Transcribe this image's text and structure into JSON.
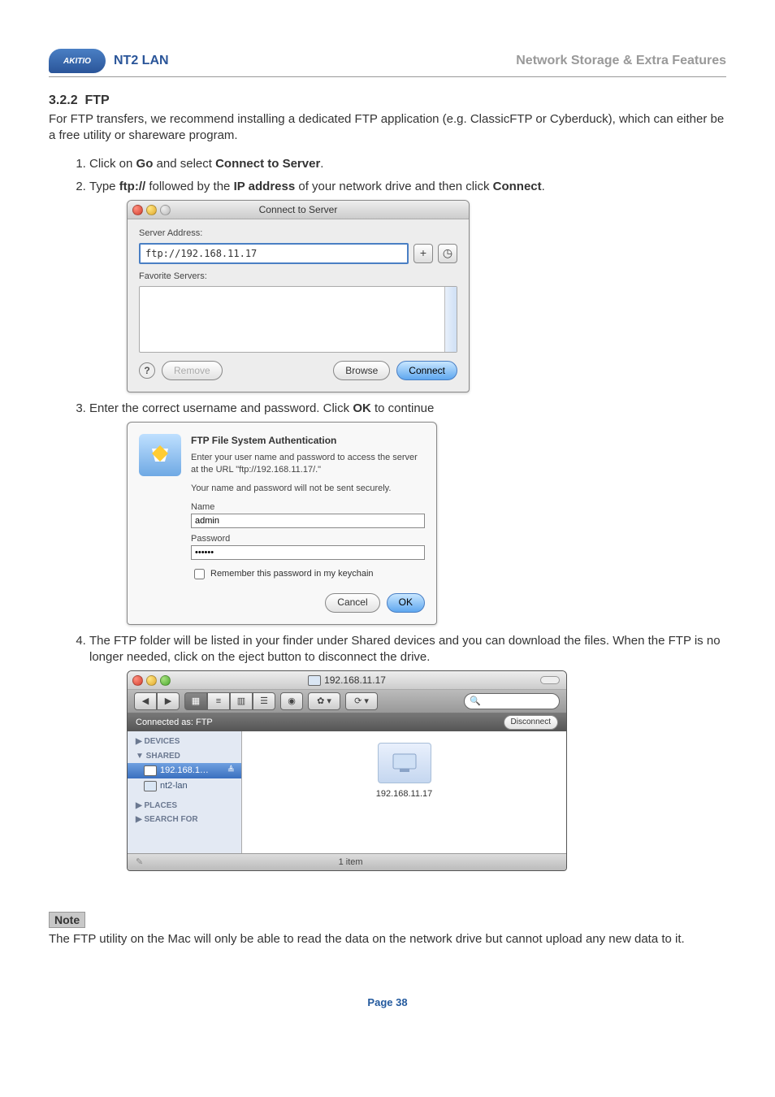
{
  "header": {
    "logo": "AKITIO",
    "title": "NT2 LAN",
    "right": "Network Storage & Extra Features"
  },
  "section": {
    "num": "3.2.2",
    "title": "FTP"
  },
  "intro": "For FTP transfers, we recommend installing a dedicated FTP application (e.g. ClassicFTP or Cyberduck), which can either be a free utility or shareware program.",
  "steps": {
    "s1a": "Click on ",
    "s1b": "Go",
    "s1c": " and select ",
    "s1d": "Connect to Server",
    "s1e": ".",
    "s2a": "Type ",
    "s2b": "ftp://",
    "s2c": " followed by the ",
    "s2d": "IP address",
    "s2e": " of your network drive and then click ",
    "s2f": "Connect",
    "s2g": ".",
    "s3a": "Enter the correct username and password. Click ",
    "s3b": "OK",
    "s3c": " to continue",
    "s4": "The FTP folder will be listed in your finder under Shared devices and you can download the files. When the FTP is no longer needed, click on the eject button to disconnect the drive."
  },
  "dlg1": {
    "title": "Connect to Server",
    "addr_label": "Server Address:",
    "addr_value": "ftp://192.168.11.17",
    "plus": "+",
    "clock": "◷",
    "fav_label": "Favorite Servers:",
    "help": "?",
    "remove": "Remove",
    "browse": "Browse",
    "connect": "Connect"
  },
  "dlg2": {
    "icon": "⚠",
    "heading": "FTP File System Authentication",
    "line1": "Enter your user name and password to access the server at the URL \"ftp://192.168.11.17/.\"",
    "line2": "Your name and password will not be sent securely.",
    "name_label": "Name",
    "name_value": "admin",
    "pwd_label": "Password",
    "pwd_value": "••••••",
    "remember": "Remember this password in my keychain",
    "cancel": "Cancel",
    "ok": "OK"
  },
  "finder": {
    "title": "192.168.11.17",
    "back": "◀",
    "fwd": "▶",
    "v1": "▦",
    "v2": "≡",
    "v3": "▥",
    "v4": "☰",
    "eye": "◉",
    "gear": "✿ ▾",
    "sync": "⟳ ▾",
    "search": "",
    "conn": "Connected as: FTP",
    "disconnect": "Disconnect",
    "dev": "▶ DEVICES",
    "shared": "▼ SHARED",
    "item1": "192.168.1…",
    "item2": "nt2-lan",
    "places": "▶ PLACES",
    "searchfor": "▶ SEARCH FOR",
    "eject": "≜",
    "folder_lbl": "192.168.11.17",
    "status_items": "1 item",
    "pencil": "✎"
  },
  "note": {
    "title": "Note",
    "text": "The FTP utility on the Mac will only be able to read the data on the network drive but cannot upload any new data to it."
  },
  "page": "Page 38"
}
